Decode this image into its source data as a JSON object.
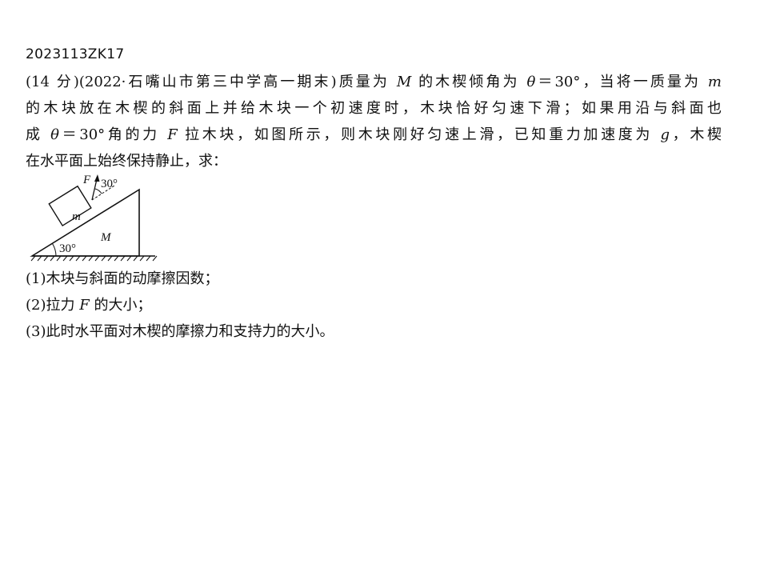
{
  "problem_code": "2023113ZK17",
  "intro": {
    "l1_a": "(14 分)(2022·石嘴山市第三中学高一期末)质量为 ",
    "var_M": "M",
    "l1_b": " 的木楔倾角为 ",
    "var_theta": "θ",
    "l1_c": "＝30°，当将一质量为 ",
    "var_m": "m",
    "l2": "的木块放在木楔的斜面上并给木块一个初速度时，木块恰好匀速下滑；如果用沿与斜面也",
    "l3_a": "成 ",
    "var_theta2": "θ",
    "l3_b": "＝30°角的力 ",
    "var_F": "F",
    "l3_c": " 拉木块，如图所示，则木块刚好匀速上滑，已知重力加速度为 ",
    "var_g": "g",
    "l3_d": "，木楔",
    "l4": "在水平面上始终保持静止，求："
  },
  "figure": {
    "label_F": "F",
    "label_top_angle": "30°",
    "label_block": "m",
    "label_wedge": "M",
    "label_base_angle": "30°"
  },
  "questions": {
    "q1": "(1)木块与斜面的动摩擦因数；",
    "q2_a": "(2)拉力 ",
    "q2_var": "F",
    "q2_b": " 的大小；",
    "q3": "(3)此时水平面对木楔的摩擦力和支持力的大小。"
  }
}
